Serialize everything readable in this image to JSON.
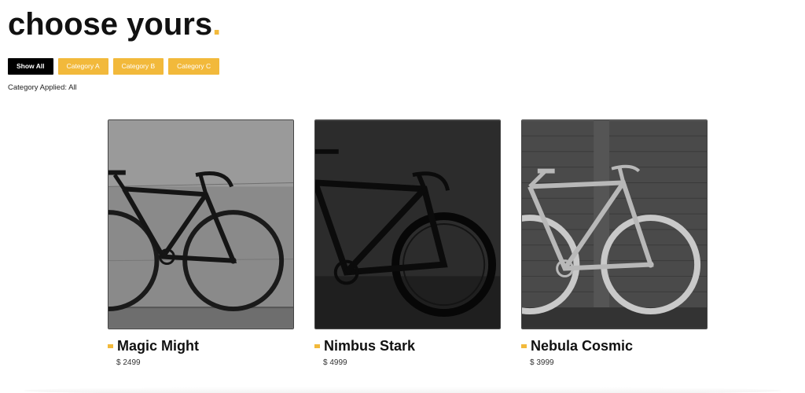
{
  "header": {
    "title": "choose yours",
    "title_dot": "."
  },
  "filters": [
    {
      "label": "Show All",
      "active": true
    },
    {
      "label": "Category A",
      "active": false
    },
    {
      "label": "Category B",
      "active": false
    },
    {
      "label": "Category C",
      "active": false
    }
  ],
  "status": {
    "text": "Category Applied: All"
  },
  "colors": {
    "accent": "#F2B93B",
    "active_filter": "#000000"
  },
  "products": [
    {
      "name": "Magic Might",
      "price": "$ 2499",
      "image": "bicycle-photo"
    },
    {
      "name": "Nimbus Stark",
      "price": "$ 4999",
      "image": "bicycle-photo"
    },
    {
      "name": "Nebula Cosmic",
      "price": "$ 3999",
      "image": "bicycle-photo"
    }
  ]
}
